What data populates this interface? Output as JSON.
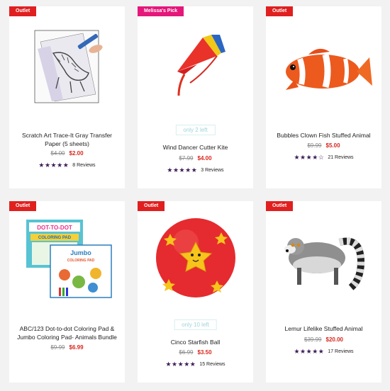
{
  "products": [
    {
      "badge": "Outlet",
      "title": "Scratch Art Trace-It Gray Transfer Paper (5 sheets)",
      "old_price": "$4.00",
      "new_price": "$2.00",
      "rating": 4.5,
      "stars": "★★★★★",
      "reviews": "8 Reviews"
    },
    {
      "badge": "Melissa's Pick",
      "stock": "only 2 left",
      "title": "Wind Dancer Cutter Kite",
      "old_price": "$7.99",
      "new_price": "$4.00",
      "rating": 5,
      "stars": "★★★★★",
      "reviews": "3 Reviews"
    },
    {
      "badge": "Outlet",
      "title": "Bubbles Clown Fish Stuffed Animal",
      "old_price": "$9.99",
      "new_price": "$5.00",
      "rating": 4,
      "stars": "★★★★☆",
      "reviews": "21 Reviews"
    },
    {
      "badge": "Outlet",
      "title": "ABC/123 Dot-to-dot Coloring Pad & Jumbo Coloring Pad- Animals Bundle",
      "old_price": "$9.99",
      "new_price": "$6.99",
      "image_text": {
        "dot": "DOT-TO-DOT",
        "coloring": "COLORING PAD",
        "jumbo": "Jumbo",
        "jumbo_coloring": "COLORING PAD"
      }
    },
    {
      "badge": "Outlet",
      "stock": "only 10 left",
      "title": "Cinco Starfish Ball",
      "old_price": "$6.99",
      "new_price": "$3.50",
      "rating": 4.5,
      "stars": "★★★★★",
      "reviews": "15 Reviews"
    },
    {
      "badge": "Outlet",
      "title": "Lemur Lifelike Stuffed Animal",
      "old_price": "$39.99",
      "new_price": "$20.00",
      "rating": 4.5,
      "stars": "★★★★★",
      "reviews": "17 Reviews"
    }
  ],
  "colors": {
    "outlet": "#e0201f",
    "pick": "#e5177b",
    "sale_price": "#d9261c",
    "stars": "#3f1d56",
    "stock": "#9fd4da"
  }
}
